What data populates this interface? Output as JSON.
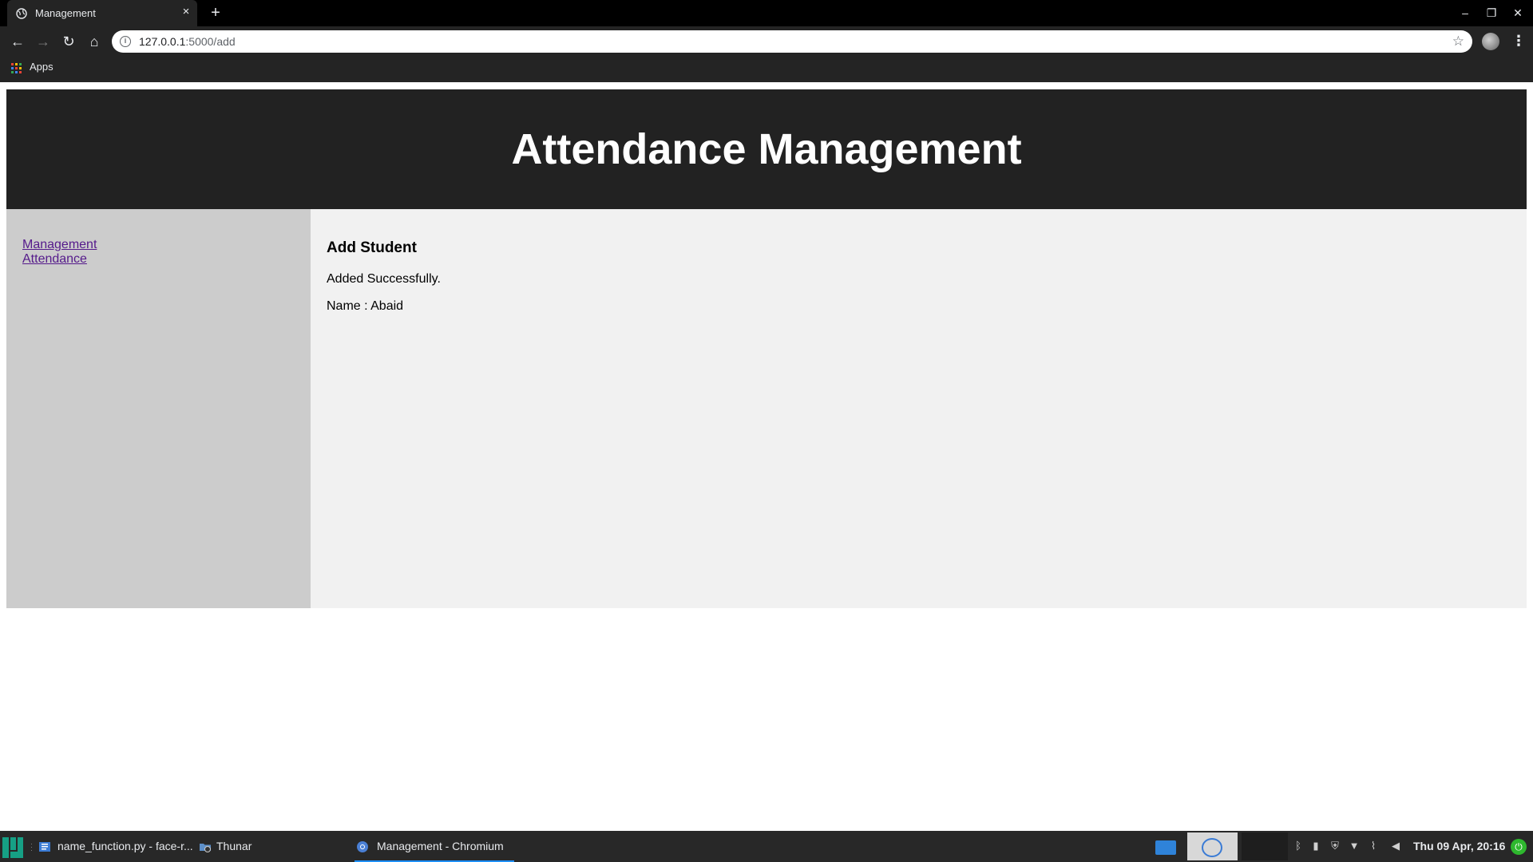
{
  "browser": {
    "tab": {
      "title": "Management",
      "close_glyph": "×"
    },
    "new_tab_glyph": "+",
    "window_controls": {
      "minimize": "–",
      "maximize": "❐",
      "close": "✕"
    },
    "nav": {
      "back": "←",
      "forward": "→",
      "reload": "↻",
      "home": "⌂"
    },
    "address": {
      "host": "127.0.0.1",
      "rest": ":5000/add",
      "info_glyph": "i",
      "star_glyph": "☆"
    },
    "menu_glyph": "⋮",
    "bookmarks": {
      "apps_label": "Apps"
    }
  },
  "page": {
    "header_title": "Attendance Management",
    "sidebar": {
      "links": [
        {
          "label": "Management"
        },
        {
          "label": "Attendance"
        }
      ]
    },
    "main": {
      "heading": "Add Student",
      "message": "Added Successfully.",
      "name_line": "Name : Abaid"
    }
  },
  "taskbar": {
    "items": [
      {
        "label": "name_function.py - face-r..."
      },
      {
        "label": "Thunar"
      },
      {
        "label": "Management - Chromium"
      }
    ],
    "clock": "Thu 09 Apr, 20:16"
  },
  "colors": {
    "header_bg": "#222222",
    "sidebar_bg": "#cccccc",
    "main_bg": "#f1f1f1",
    "link": "#551a8b",
    "taskbar_accent": "#1e90ff"
  },
  "icons": {
    "tab_favicon": "globe-icon",
    "info": "info-icon",
    "star": "star-icon",
    "profile": "avatar",
    "apps": "apps-grid-icon",
    "start": "manjaro-logo-icon",
    "power": "power-icon"
  }
}
